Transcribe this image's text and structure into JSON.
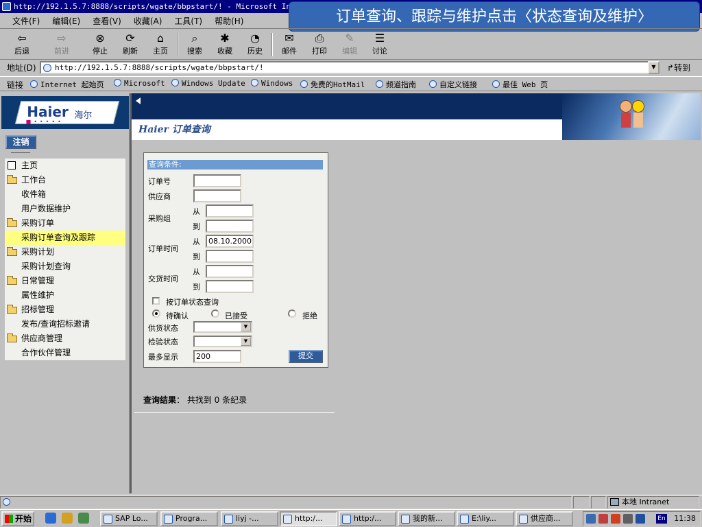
{
  "window": {
    "title": "http://192.1.5.7:8888/scripts/wgate/bbpstart/! - Microsoft Internet Explorer"
  },
  "callout": "订单查询、跟踪与维护点击〈状态查询及维护〉",
  "menu": [
    "文件(F)",
    "编辑(E)",
    "查看(V)",
    "收藏(A)",
    "工具(T)",
    "帮助(H)"
  ],
  "toolbar": {
    "back": "后退",
    "forward": "前进",
    "stop": "停止",
    "refresh": "刷新",
    "home": "主页",
    "search": "搜索",
    "favorites": "收藏",
    "history": "历史",
    "mail": "邮件",
    "print": "打印",
    "edit": "编辑",
    "discuss": "讨论"
  },
  "address": {
    "label": "地址(D)",
    "url": "http://192.1.5.7:8888/scripts/wgate/bbpstart/!",
    "go": "转到"
  },
  "links": {
    "label": "链接",
    "items": [
      "Internet 起始页",
      "Microsoft",
      "Windows Update",
      "Windows",
      "免费的HotMail",
      "频道指南",
      "自定义链接",
      "最佳 Web 页"
    ]
  },
  "sidebar": {
    "logo_en": "Haier",
    "logo_cn": "海尔",
    "logout": "注销",
    "items": [
      {
        "label": "主页",
        "kind": "home"
      },
      {
        "label": "工作台",
        "kind": "folder"
      },
      {
        "label": "收件箱",
        "kind": "sub"
      },
      {
        "label": "用户数据维护",
        "kind": "sub"
      },
      {
        "label": "采购订单",
        "kind": "folder"
      },
      {
        "label": "采购订单查询及跟踪",
        "kind": "sub-active"
      },
      {
        "label": "采购计划",
        "kind": "folder"
      },
      {
        "label": "采购计划查询",
        "kind": "sub"
      },
      {
        "label": "日常管理",
        "kind": "folder"
      },
      {
        "label": "属性维护",
        "kind": "sub"
      },
      {
        "label": "招标管理",
        "kind": "folder"
      },
      {
        "label": "发布/查询招标邀请",
        "kind": "sub"
      },
      {
        "label": "供应商管理",
        "kind": "folder"
      },
      {
        "label": "合作伙伴管理",
        "kind": "sub"
      }
    ]
  },
  "content": {
    "title": "Haier 订单查询",
    "form": {
      "header": "查询条件:",
      "order_no": "订单号",
      "supplier": "供应商",
      "purchase_group": "采购组",
      "order_time": "订单时间",
      "delivery_time": "交货时间",
      "from": "从",
      "to": "到",
      "order_time_from_value": "08.10.2000",
      "status_query": "按订单状态查询",
      "radio_pending": "待确认",
      "radio_accepted": "已接受",
      "radio_rejected": "拒绝",
      "supply_status": "供货状态",
      "inspect_status": "检验状态",
      "max_show": "最多显示",
      "max_show_value": "200",
      "submit": "提交"
    },
    "result": {
      "label": "查询结果",
      "text": "：  共找到 0 条纪录"
    }
  },
  "statusbar": {
    "zone": "本地 Intranet"
  },
  "taskbar": {
    "start": "开始",
    "tasks": [
      "SAP Lo...",
      "Progra...",
      "liyj -...",
      "http:/...",
      "http:/...",
      "我的新...",
      "E:\\liy...",
      "供应商..."
    ],
    "lang": "En",
    "clock": "11:38"
  }
}
